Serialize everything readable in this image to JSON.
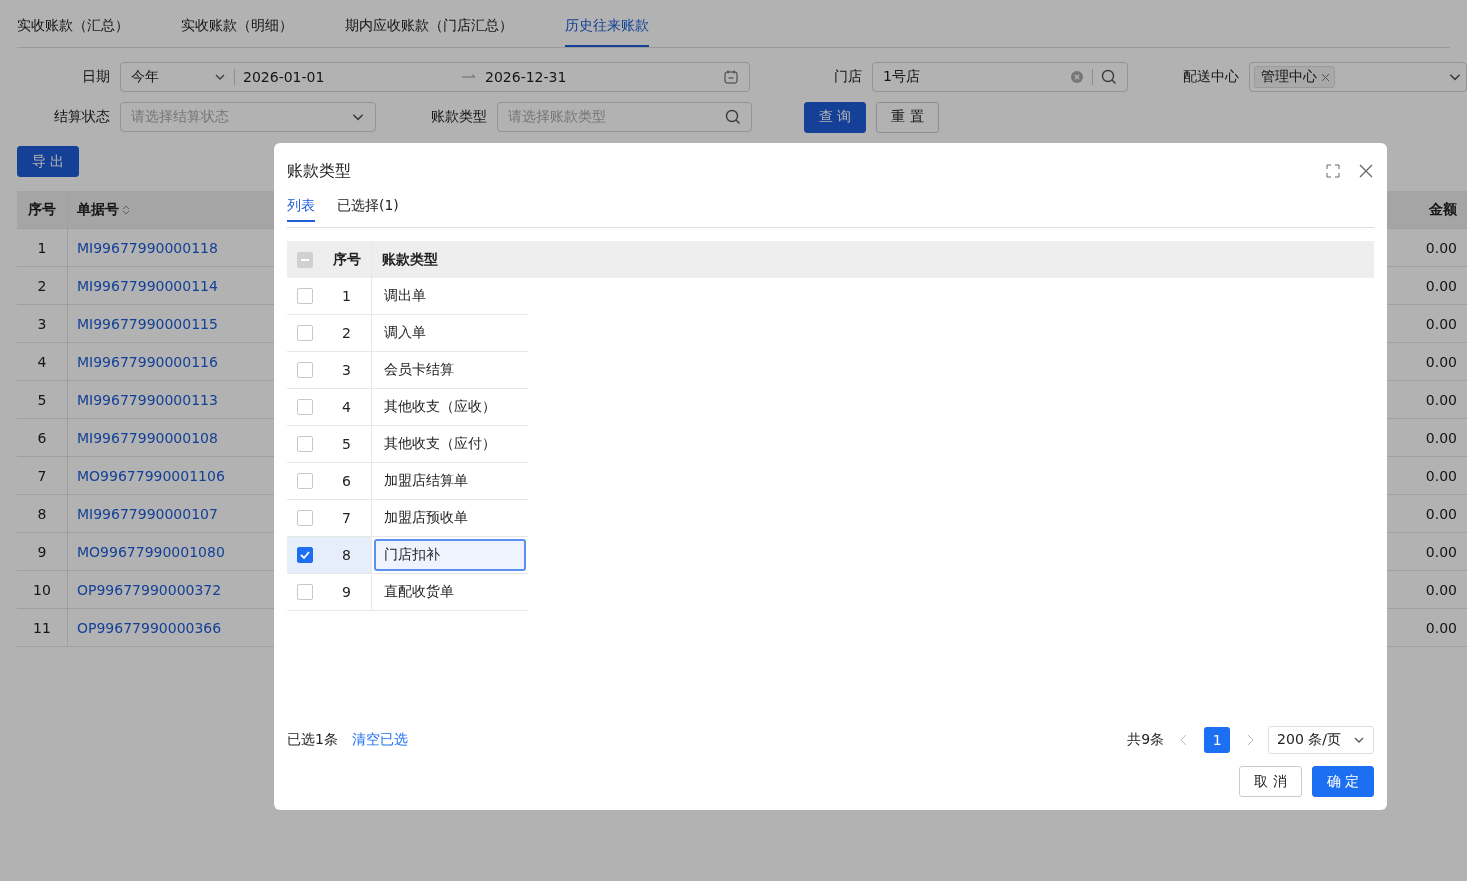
{
  "tabs": [
    {
      "label": "实收账款（汇总）",
      "selected": false
    },
    {
      "label": "实收账款（明细）",
      "selected": false
    },
    {
      "label": "期内应收账款（门店汇总）",
      "selected": false
    },
    {
      "label": "历史往来账款",
      "selected": true
    }
  ],
  "filters": {
    "date": {
      "label": "日期",
      "preset": "今年",
      "start": "2026-01-01",
      "end": "2026-12-31"
    },
    "store": {
      "label": "门店",
      "value": "1号店"
    },
    "center": {
      "label": "配送中心",
      "tags": [
        "管理中心"
      ]
    },
    "status": {
      "label": "结算状态",
      "placeholder": "请选择结算状态"
    },
    "type": {
      "label": "账款类型",
      "placeholder": "请选择账款类型"
    },
    "buttons": [
      {
        "label": "查 询",
        "kind": "primary"
      },
      {
        "label": "重 置",
        "kind": "default"
      }
    ]
  },
  "export_button": "导 出",
  "table": {
    "columns": [
      "序号",
      "单据号",
      "金额"
    ],
    "rows": [
      [
        "1",
        "MI99677990000118",
        "0.00"
      ],
      [
        "2",
        "MI99677990000114",
        "0.00"
      ],
      [
        "3",
        "MI99677990000115",
        "0.00"
      ],
      [
        "4",
        "MI99677990000116",
        "0.00"
      ],
      [
        "5",
        "MI99677990000113",
        "0.00"
      ],
      [
        "6",
        "MI99677990000108",
        "0.00"
      ],
      [
        "7",
        "MO99677990001106",
        "0.00"
      ],
      [
        "8",
        "MI99677990000107",
        "0.00"
      ],
      [
        "9",
        "MO99677990001080",
        "0.00"
      ],
      [
        "10",
        "OP99677990000372",
        "0.00"
      ],
      [
        "11",
        "OP99677990000366",
        "0.00"
      ]
    ]
  },
  "dialog": {
    "title": "账款类型",
    "tabs": [
      {
        "label": "列表",
        "selected": true
      },
      {
        "label": "已选择(1)",
        "selected": false
      }
    ],
    "header_checkbox": {
      "indeterminate": true
    },
    "columns": [
      "序号",
      "账款类型"
    ],
    "rows": [
      {
        "seq": "1",
        "name": "调出单",
        "checked": false,
        "selected": false
      },
      {
        "seq": "2",
        "name": "调入单",
        "checked": false,
        "selected": false
      },
      {
        "seq": "3",
        "name": "会员卡结算",
        "checked": false,
        "selected": false
      },
      {
        "seq": "4",
        "name": "其他收支（应收）",
        "checked": false,
        "selected": false
      },
      {
        "seq": "5",
        "name": "其他收支（应付）",
        "checked": false,
        "selected": false
      },
      {
        "seq": "6",
        "name": "加盟店结算单",
        "checked": false,
        "selected": false
      },
      {
        "seq": "7",
        "name": "加盟店预收单",
        "checked": false,
        "selected": false
      },
      {
        "seq": "8",
        "name": "门店扣补",
        "checked": true,
        "selected": true
      },
      {
        "seq": "9",
        "name": "直配收货单",
        "checked": false,
        "selected": false
      }
    ],
    "selected_count": "已选1条",
    "clear_link": "清空已选",
    "pagination": {
      "total": "共9条",
      "pages": [
        {
          "label": "1",
          "selected": true
        }
      ],
      "page_size": "200 条/页"
    },
    "buttons": [
      {
        "label": "取 消",
        "kind": "default"
      },
      {
        "label": "确 定",
        "kind": "primary"
      }
    ]
  }
}
